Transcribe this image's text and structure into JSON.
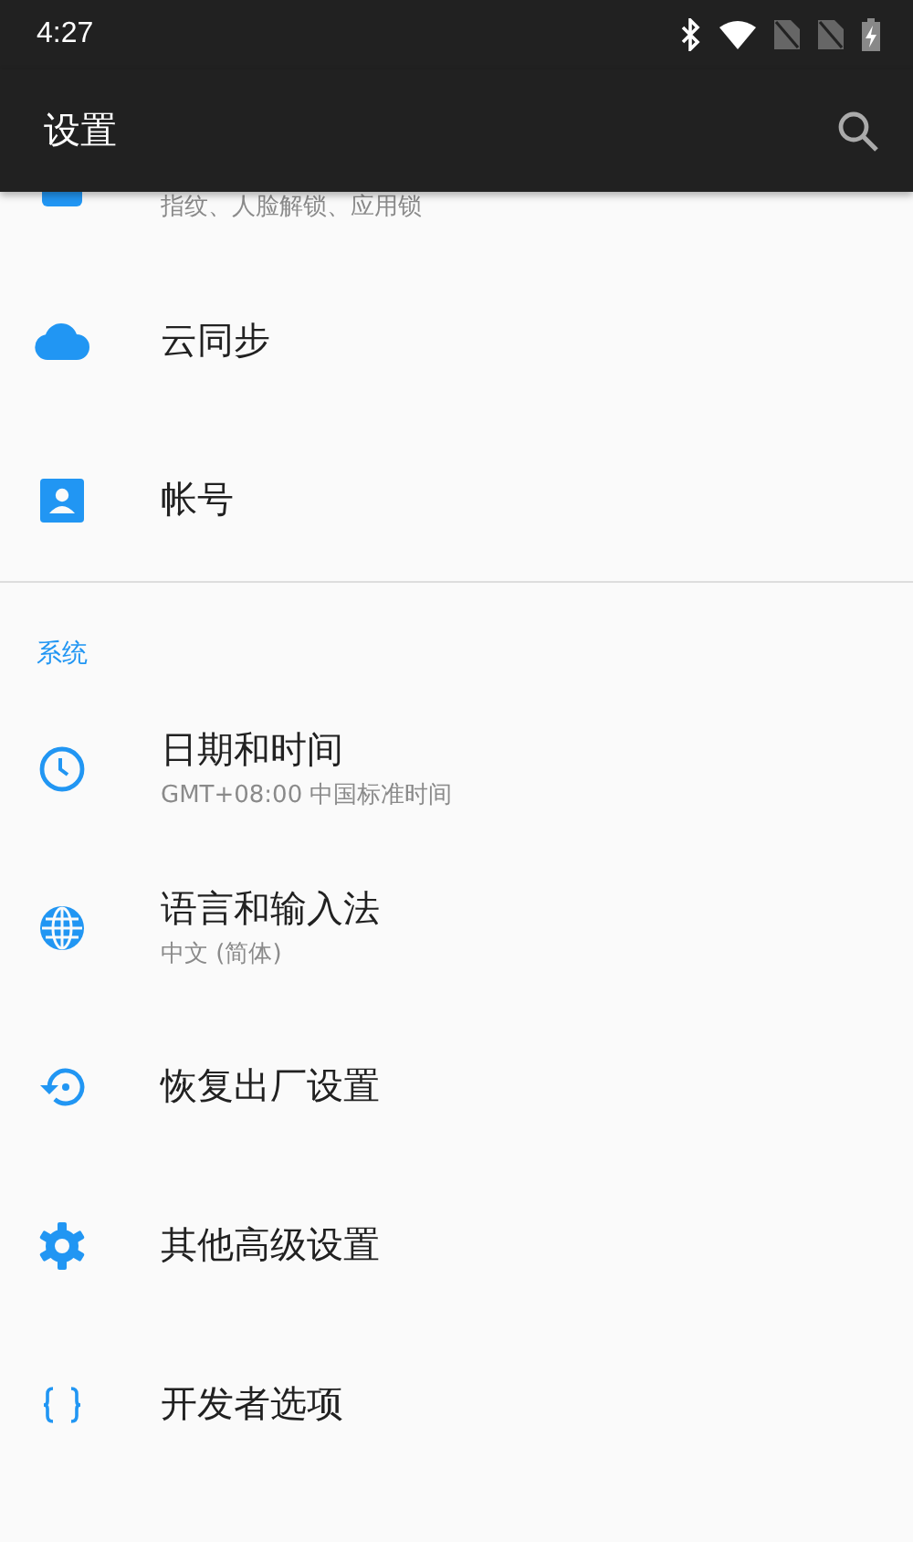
{
  "status_bar": {
    "time": "4:27"
  },
  "toolbar": {
    "title": "设置"
  },
  "partial_item": {
    "subtitle": "指纹、人脸解锁、应用锁"
  },
  "items": [
    {
      "title": "云同步"
    },
    {
      "title": "帐号"
    }
  ],
  "section": {
    "header": "系统",
    "items": [
      {
        "title": "日期和时间",
        "subtitle": "GMT+08:00 中国标准时间"
      },
      {
        "title": "语言和输入法",
        "subtitle": "中文 (简体)"
      },
      {
        "title": "恢复出厂设置"
      },
      {
        "title": "其他高级设置"
      },
      {
        "title": "开发者选项"
      }
    ]
  }
}
